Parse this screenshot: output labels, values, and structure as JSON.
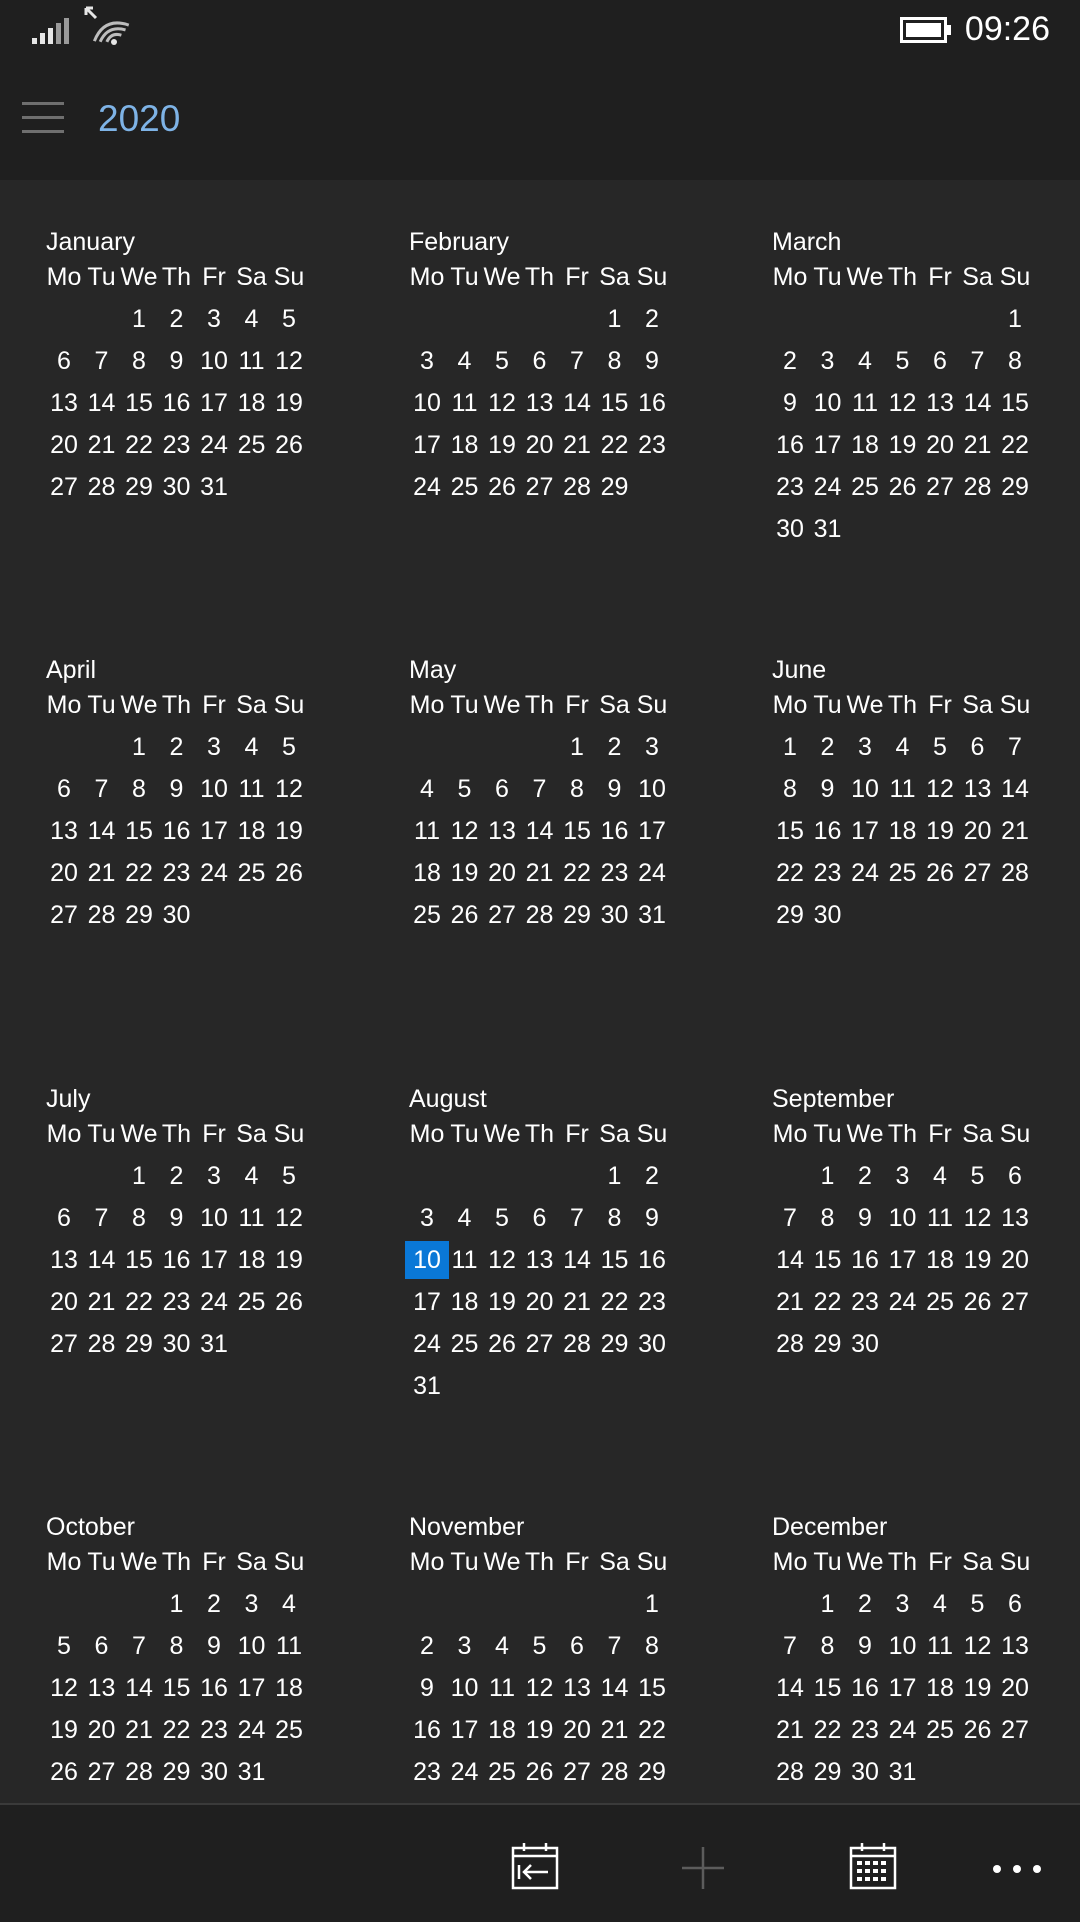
{
  "status_bar": {
    "time": "09:26",
    "icons": [
      "signal-icon",
      "wifi-icon",
      "battery-icon"
    ]
  },
  "header": {
    "title": "2020",
    "menu_icon": "hamburger-menu-icon"
  },
  "weekday_labels": [
    "Mo",
    "Tu",
    "We",
    "Th",
    "Fr",
    "Sa",
    "Su"
  ],
  "months": [
    {
      "name": "January",
      "weeks": [
        [
          "",
          "",
          "1",
          "2",
          "3",
          "4",
          "5"
        ],
        [
          "6",
          "7",
          "8",
          "9",
          "10",
          "11",
          "12"
        ],
        [
          "13",
          "14",
          "15",
          "16",
          "17",
          "18",
          "19"
        ],
        [
          "20",
          "21",
          "22",
          "23",
          "24",
          "25",
          "26"
        ],
        [
          "27",
          "28",
          "29",
          "30",
          "31",
          "",
          ""
        ]
      ]
    },
    {
      "name": "February",
      "weeks": [
        [
          "",
          "",
          "",
          "",
          "",
          "1",
          "2"
        ],
        [
          "3",
          "4",
          "5",
          "6",
          "7",
          "8",
          "9"
        ],
        [
          "10",
          "11",
          "12",
          "13",
          "14",
          "15",
          "16"
        ],
        [
          "17",
          "18",
          "19",
          "20",
          "21",
          "22",
          "23"
        ],
        [
          "24",
          "25",
          "26",
          "27",
          "28",
          "29",
          ""
        ]
      ]
    },
    {
      "name": "March",
      "weeks": [
        [
          "",
          "",
          "",
          "",
          "",
          "",
          "1"
        ],
        [
          "2",
          "3",
          "4",
          "5",
          "6",
          "7",
          "8"
        ],
        [
          "9",
          "10",
          "11",
          "12",
          "13",
          "14",
          "15"
        ],
        [
          "16",
          "17",
          "18",
          "19",
          "20",
          "21",
          "22"
        ],
        [
          "23",
          "24",
          "25",
          "26",
          "27",
          "28",
          "29"
        ],
        [
          "30",
          "31",
          "",
          "",
          "",
          "",
          ""
        ]
      ]
    },
    {
      "name": "April",
      "weeks": [
        [
          "",
          "",
          "1",
          "2",
          "3",
          "4",
          "5"
        ],
        [
          "6",
          "7",
          "8",
          "9",
          "10",
          "11",
          "12"
        ],
        [
          "13",
          "14",
          "15",
          "16",
          "17",
          "18",
          "19"
        ],
        [
          "20",
          "21",
          "22",
          "23",
          "24",
          "25",
          "26"
        ],
        [
          "27",
          "28",
          "29",
          "30",
          "",
          "",
          ""
        ]
      ]
    },
    {
      "name": "May",
      "weeks": [
        [
          "",
          "",
          "",
          "",
          "1",
          "2",
          "3"
        ],
        [
          "4",
          "5",
          "6",
          "7",
          "8",
          "9",
          "10"
        ],
        [
          "11",
          "12",
          "13",
          "14",
          "15",
          "16",
          "17"
        ],
        [
          "18",
          "19",
          "20",
          "21",
          "22",
          "23",
          "24"
        ],
        [
          "25",
          "26",
          "27",
          "28",
          "29",
          "30",
          "31"
        ]
      ]
    },
    {
      "name": "June",
      "weeks": [
        [
          "1",
          "2",
          "3",
          "4",
          "5",
          "6",
          "7"
        ],
        [
          "8",
          "9",
          "10",
          "11",
          "12",
          "13",
          "14"
        ],
        [
          "15",
          "16",
          "17",
          "18",
          "19",
          "20",
          "21"
        ],
        [
          "22",
          "23",
          "24",
          "25",
          "26",
          "27",
          "28"
        ],
        [
          "29",
          "30",
          "",
          "",
          "",
          "",
          ""
        ]
      ]
    },
    {
      "name": "July",
      "weeks": [
        [
          "",
          "",
          "1",
          "2",
          "3",
          "4",
          "5"
        ],
        [
          "6",
          "7",
          "8",
          "9",
          "10",
          "11",
          "12"
        ],
        [
          "13",
          "14",
          "15",
          "16",
          "17",
          "18",
          "19"
        ],
        [
          "20",
          "21",
          "22",
          "23",
          "24",
          "25",
          "26"
        ],
        [
          "27",
          "28",
          "29",
          "30",
          "31",
          "",
          ""
        ]
      ]
    },
    {
      "name": "August",
      "weeks": [
        [
          "",
          "",
          "",
          "",
          "",
          "1",
          "2"
        ],
        [
          "3",
          "4",
          "5",
          "6",
          "7",
          "8",
          "9"
        ],
        [
          "10",
          "11",
          "12",
          "13",
          "14",
          "15",
          "16"
        ],
        [
          "17",
          "18",
          "19",
          "20",
          "21",
          "22",
          "23"
        ],
        [
          "24",
          "25",
          "26",
          "27",
          "28",
          "29",
          "30"
        ],
        [
          "31",
          "",
          "",
          "",
          "",
          "",
          ""
        ]
      ]
    },
    {
      "name": "September",
      "weeks": [
        [
          "",
          "1",
          "2",
          "3",
          "4",
          "5",
          "6"
        ],
        [
          "7",
          "8",
          "9",
          "10",
          "11",
          "12",
          "13"
        ],
        [
          "14",
          "15",
          "16",
          "17",
          "18",
          "19",
          "20"
        ],
        [
          "21",
          "22",
          "23",
          "24",
          "25",
          "26",
          "27"
        ],
        [
          "28",
          "29",
          "30",
          "",
          "",
          "",
          ""
        ]
      ]
    },
    {
      "name": "October",
      "weeks": [
        [
          "",
          "",
          "",
          "1",
          "2",
          "3",
          "4"
        ],
        [
          "5",
          "6",
          "7",
          "8",
          "9",
          "10",
          "11"
        ],
        [
          "12",
          "13",
          "14",
          "15",
          "16",
          "17",
          "18"
        ],
        [
          "19",
          "20",
          "21",
          "22",
          "23",
          "24",
          "25"
        ],
        [
          "26",
          "27",
          "28",
          "29",
          "30",
          "31",
          ""
        ]
      ]
    },
    {
      "name": "November",
      "weeks": [
        [
          "",
          "",
          "",
          "",
          "",
          "",
          "1"
        ],
        [
          "2",
          "3",
          "4",
          "5",
          "6",
          "7",
          "8"
        ],
        [
          "9",
          "10",
          "11",
          "12",
          "13",
          "14",
          "15"
        ],
        [
          "16",
          "17",
          "18",
          "19",
          "20",
          "21",
          "22"
        ],
        [
          "23",
          "24",
          "25",
          "26",
          "27",
          "28",
          "29"
        ]
      ]
    },
    {
      "name": "December",
      "weeks": [
        [
          "",
          "1",
          "2",
          "3",
          "4",
          "5",
          "6"
        ],
        [
          "7",
          "8",
          "9",
          "10",
          "11",
          "12",
          "13"
        ],
        [
          "14",
          "15",
          "16",
          "17",
          "18",
          "19",
          "20"
        ],
        [
          "21",
          "22",
          "23",
          "24",
          "25",
          "26",
          "27"
        ],
        [
          "28",
          "29",
          "30",
          "31",
          "",
          "",
          ""
        ]
      ]
    }
  ],
  "today": {
    "month": "August",
    "day": "10"
  },
  "colors": {
    "background": "#272727",
    "bars": "#1f1f1f",
    "accent": "#0a78d7",
    "title": "#7eb3e6"
  },
  "bottom_bar": {
    "buttons": [
      "go-to-today-icon",
      "add-icon",
      "calendar-view-icon",
      "more-icon"
    ]
  }
}
